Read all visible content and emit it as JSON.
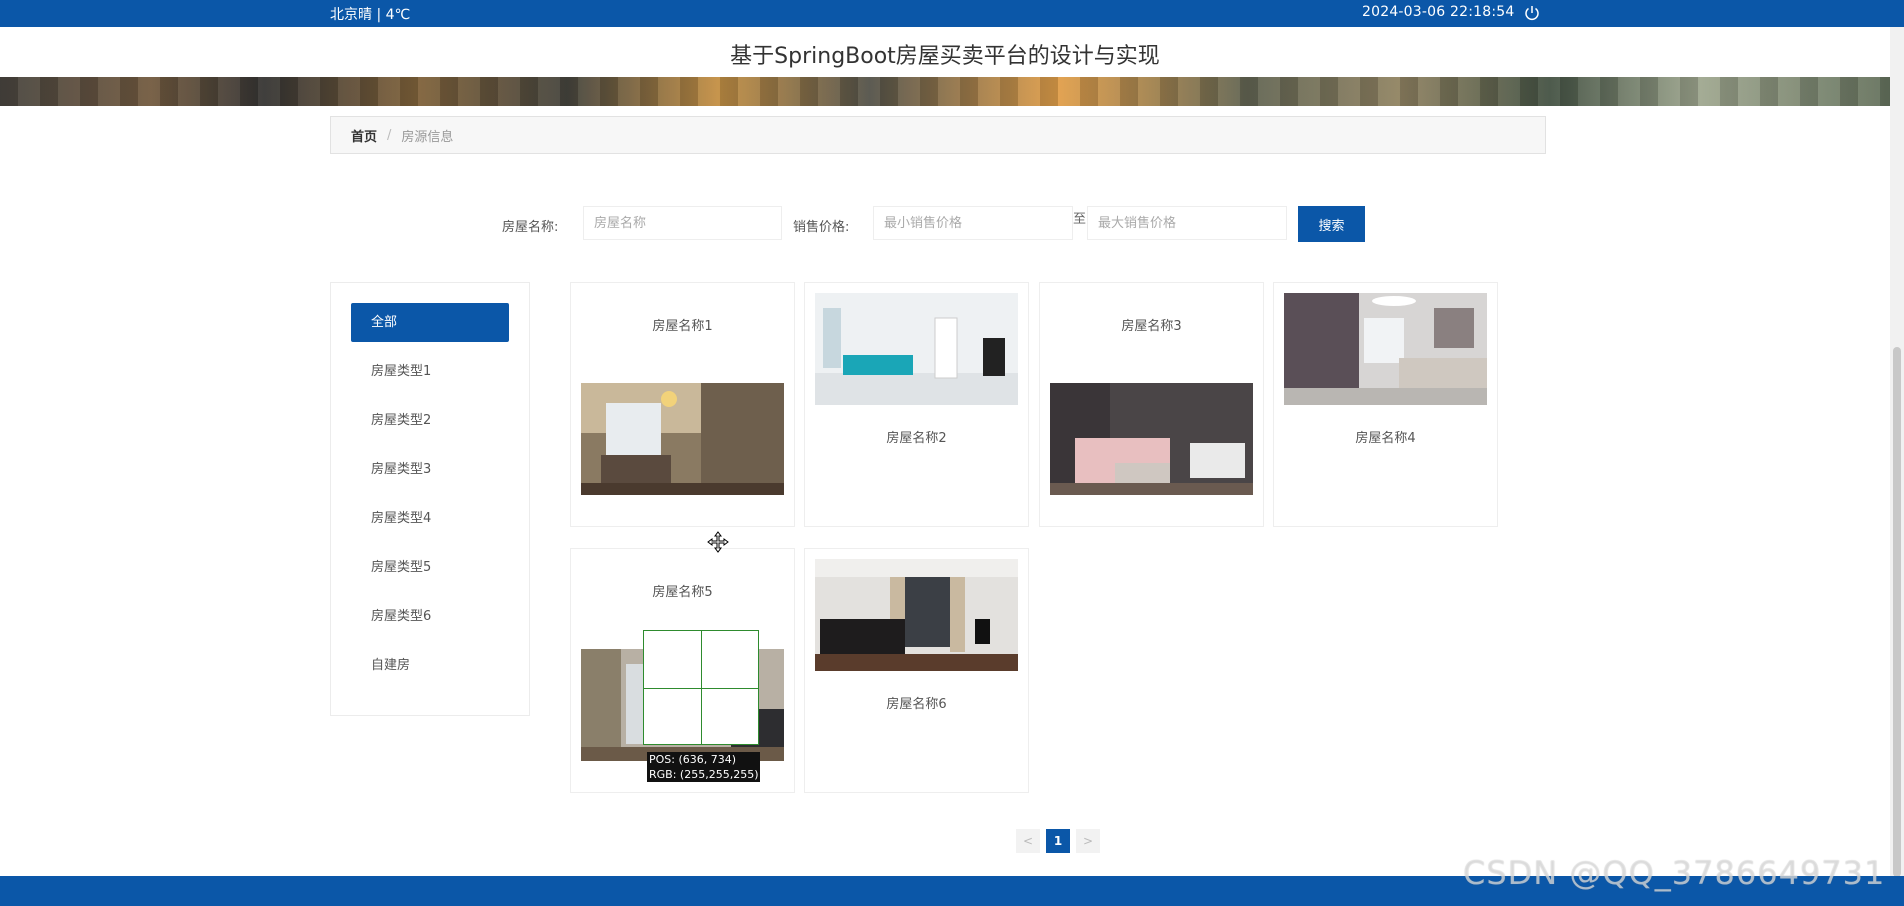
{
  "topbar": {
    "weather": "北京晴 | 4℃",
    "datetime": "2024-03-06   22:18:54"
  },
  "header": {
    "title": "基于SpringBoot房屋买卖平台的设计与实现"
  },
  "breadcrumb": {
    "home": "首页",
    "separator": "/",
    "current": "房源信息"
  },
  "search": {
    "name_label": "房屋名称:",
    "name_placeholder": "房屋名称",
    "price_label": "销售价格:",
    "min_placeholder": "最小销售价格",
    "to_text": "至",
    "max_placeholder": "最大销售价格",
    "button_label": "搜索"
  },
  "sidebar": {
    "items": [
      {
        "label": "全部",
        "active": true
      },
      {
        "label": "房屋类型1"
      },
      {
        "label": "房屋类型2"
      },
      {
        "label": "房屋类型3"
      },
      {
        "label": "房屋类型4"
      },
      {
        "label": "房屋类型5"
      },
      {
        "label": "房屋类型6"
      },
      {
        "label": "自建房"
      }
    ]
  },
  "listings": [
    {
      "name": "房屋名称1"
    },
    {
      "name": "房屋名称2"
    },
    {
      "name": "房屋名称3"
    },
    {
      "name": "房屋名称4"
    },
    {
      "name": "房屋名称5"
    },
    {
      "name": "房屋名称6"
    }
  ],
  "pagination": {
    "prev": "<",
    "current": "1",
    "next": ">"
  },
  "overlay": {
    "pos": "POS:  (636, 734)",
    "rgb": "RGB:  (255,255,255)"
  },
  "watermark": "CSDN @QQ_3786649731",
  "colors": {
    "primary": "#0b57a8",
    "border": "#eeeeee"
  },
  "icons": {
    "power": "power-icon",
    "move_cursor": "move-cursor-icon"
  }
}
